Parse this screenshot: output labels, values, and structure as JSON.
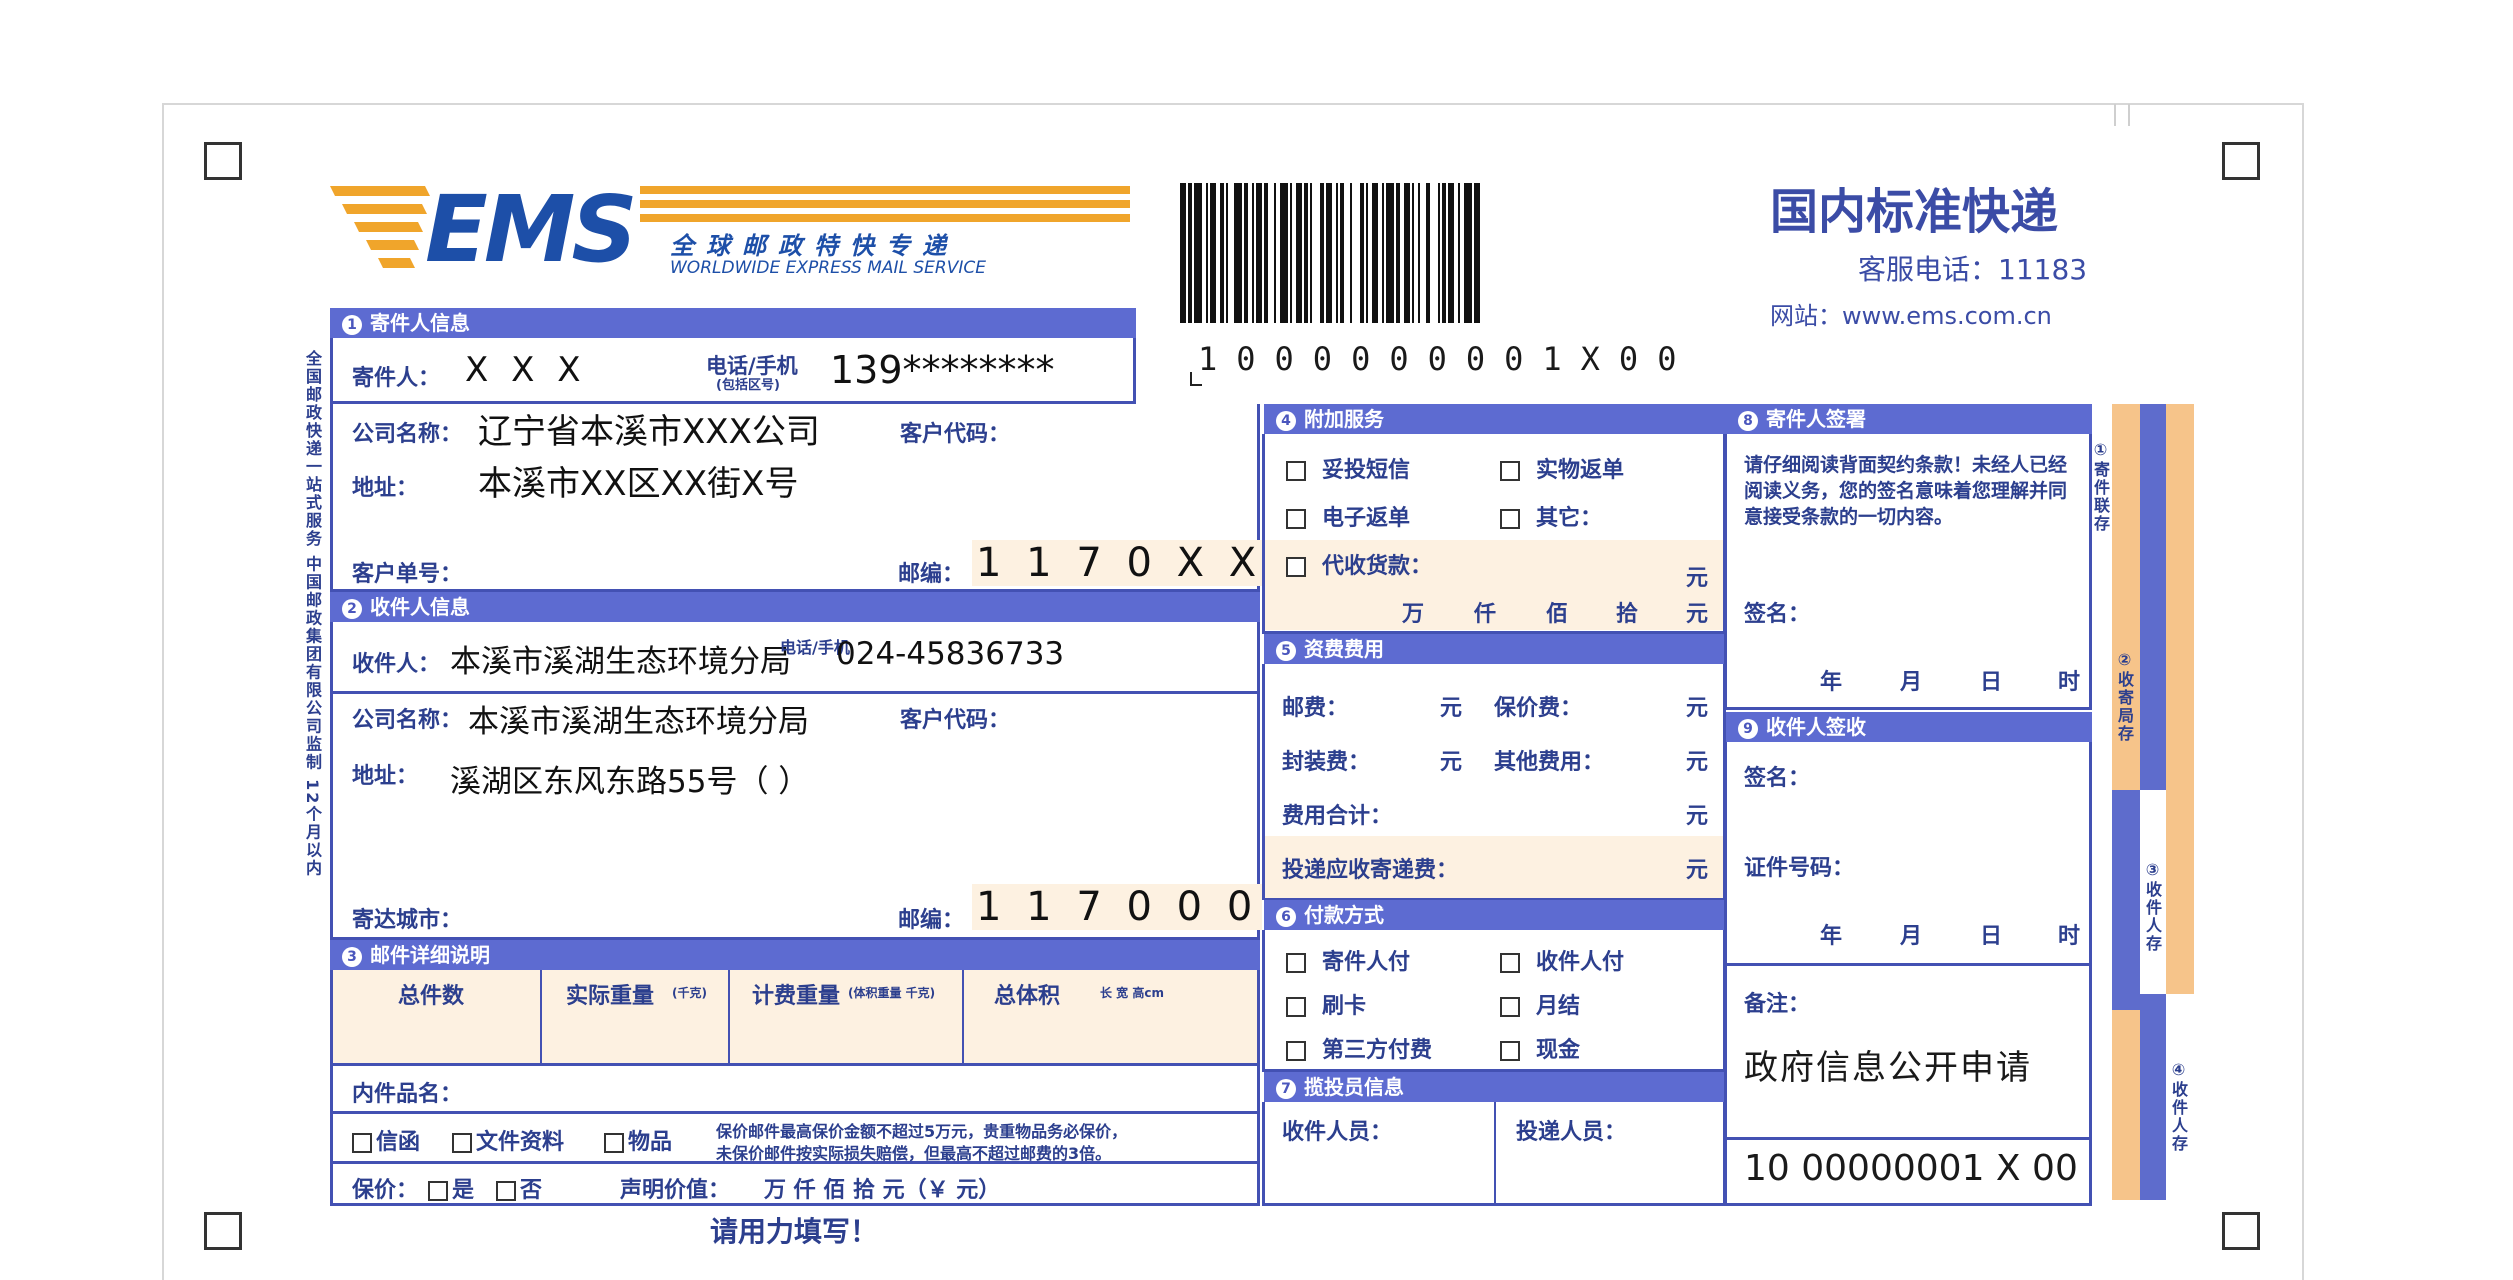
{
  "header": {
    "logo_text": "EMS",
    "logo_cn": "全球邮政特快专递",
    "logo_en": "WORLDWIDE EXPRESS MAIL SERVICE",
    "service_title": "国内标准快递",
    "hotline": "客服电话：11183",
    "website": "网站：www.ems.com.cn",
    "tracking_number": "1000000001X00",
    "tracking_number_bottom": "10 00000001 X 00"
  },
  "sender": {
    "section_title": "寄件人信息",
    "name_label": "寄件人：",
    "name_value": "X X X",
    "phone_label": "电话/手机",
    "phone_sub": "(包括区号)",
    "phone_value": "139********",
    "company_label": "公司名称：",
    "company_value": "辽宁省本溪市XXX公司",
    "client_code_label": "客户代码：",
    "address_label": "地址：",
    "address_value": "本溪市XX区XX街X号",
    "client_order_label": "客户单号：",
    "zip_label": "邮编：",
    "zip_value": "1 1 7 0 X X"
  },
  "recipient": {
    "section_title": "收件人信息",
    "name_label": "收件人：",
    "name_value": "本溪市溪湖生态环境分局",
    "phone_label": "电话/手机",
    "phone_value": "024-45836733",
    "company_label": "公司名称：",
    "company_value": "本溪市溪湖生态环境分局",
    "client_code_label": "客户代码：",
    "address_label": "地址：",
    "address_value": "溪湖区东风东路55号（          ）",
    "city_label": "寄达城市：",
    "zip_label": "邮编：",
    "zip_value": "1 1 7 0 0 0"
  },
  "items": {
    "section_title": "邮件详细说明",
    "col_total": "总件数",
    "col_actual_weight": "实际重量",
    "col_actual_weight_unit": "(千克)",
    "col_billed_weight": "计费重量",
    "col_billed_weight_unit": "(体积重量 千克)",
    "col_volume": "总体积",
    "col_volume_unit": "长  宽  高cm",
    "contents_label": "内件品名：",
    "opt_docs": "信函",
    "opt_files": "文件资料",
    "opt_goods": "物品",
    "note_line1": "保价邮件最高保价金额不超过5万元，贵重物品务必保价，",
    "note_line2": "未保价邮件按实际损失赔偿，但最高不超过邮费的3倍。",
    "insure_label": "保价：",
    "insure_yes": "是",
    "insure_no": "否",
    "declared_label": "声明价值：",
    "declared_units": "万   仟   佰   拾   元（￥               元）",
    "press_hard": "请用力填写！"
  },
  "services": {
    "section_title": "附加服务",
    "opt_sms": "妥投短信",
    "opt_physical_return": "实物返单",
    "opt_e_return": "电子返单",
    "opt_other": "其它：",
    "opt_cod": "代收货款：",
    "yuan": "元",
    "units": [
      "万",
      "仟",
      "佰",
      "拾",
      "元"
    ]
  },
  "fees": {
    "section_title": "资费费用",
    "postage": "邮费：",
    "insurance": "保价费：",
    "packaging": "封装费：",
    "other": "其他费用：",
    "total": "费用合计：",
    "return_fee": "投递应收寄递费：",
    "yuan": "元"
  },
  "payment": {
    "section_title": "付款方式",
    "opt_sender": "寄件人付",
    "opt_recipient": "收件人付",
    "opt_card": "刷卡",
    "opt_monthly": "月结",
    "opt_third": "第三方付费",
    "opt_cash": "现金"
  },
  "staff": {
    "section_title": "揽投员信息",
    "collector": "收件人员：",
    "deliverer": "投递人员："
  },
  "sender_sign": {
    "section_title": "寄件人签署",
    "statement": "请仔细阅读背面契约条款！未经人已经阅读义务，您的签名意味着您理解并同意接受条款的一切内容。",
    "sign_label": "签名：",
    "date": [
      "年",
      "月",
      "日",
      "时"
    ]
  },
  "recipient_sign": {
    "section_title": "收件人签收",
    "sign_label": "签名：",
    "id_label": "证件号码：",
    "date": [
      "年",
      "月",
      "日",
      "时"
    ]
  },
  "remarks": {
    "label": "备注：",
    "value": "政府信息公开申请"
  },
  "side": {
    "left_text": "全国邮政快递一站式服务 中国邮政集团有限公司监制  12个月以内",
    "right_1": "①寄件联存",
    "right_2": "②收寄局存",
    "right_3": "③收件人存",
    "right_4": "④收件人存"
  },
  "colors": {
    "ems_blue": "#1d4fa8",
    "ems_gold": "#f0a52b",
    "form_blue": "#4351b3",
    "highlight": "#fdf1e1"
  }
}
